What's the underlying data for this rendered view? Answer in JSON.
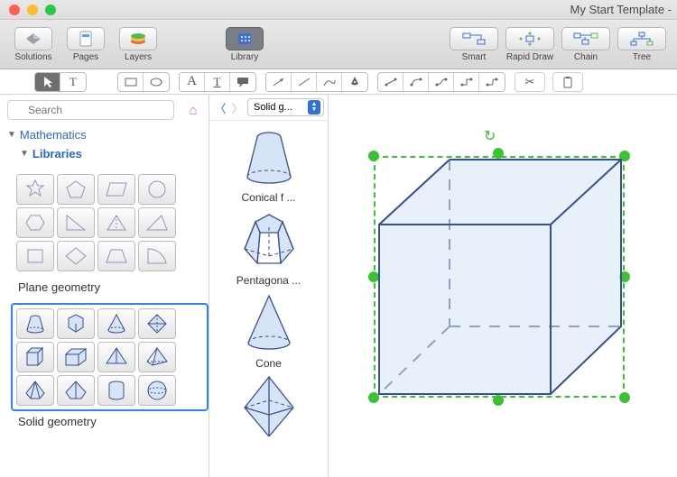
{
  "window": {
    "title": "My Start Template -"
  },
  "main_toolbar": {
    "left": [
      {
        "label": "Solutions",
        "icon": "solutions"
      },
      {
        "label": "Pages",
        "icon": "pages"
      },
      {
        "label": "Layers",
        "icon": "layers"
      }
    ],
    "center": [
      {
        "label": "Library",
        "icon": "library",
        "selected": true
      }
    ],
    "right": [
      {
        "label": "Smart",
        "icon": "smart"
      },
      {
        "label": "Rapid Draw",
        "icon": "rapid-draw"
      },
      {
        "label": "Chain",
        "icon": "chain"
      },
      {
        "label": "Tree",
        "icon": "tree"
      }
    ]
  },
  "search": {
    "placeholder": "Search"
  },
  "tree": {
    "root": "Mathematics",
    "child": "Libraries"
  },
  "plane": {
    "title": "Plane geometry"
  },
  "solid": {
    "title": "Solid geometry"
  },
  "lib_panel": {
    "dropdown": "Solid g...",
    "items": [
      {
        "label": "Conical f ..."
      },
      {
        "label": "Pentagona ..."
      },
      {
        "label": "Cone"
      },
      {
        "label": ""
      }
    ]
  },
  "colors": {
    "accent": "#2f6fe0",
    "selection": "#39c331",
    "shape_stroke": "#3a4f8f",
    "shape_fill": "#d6e5f5"
  }
}
